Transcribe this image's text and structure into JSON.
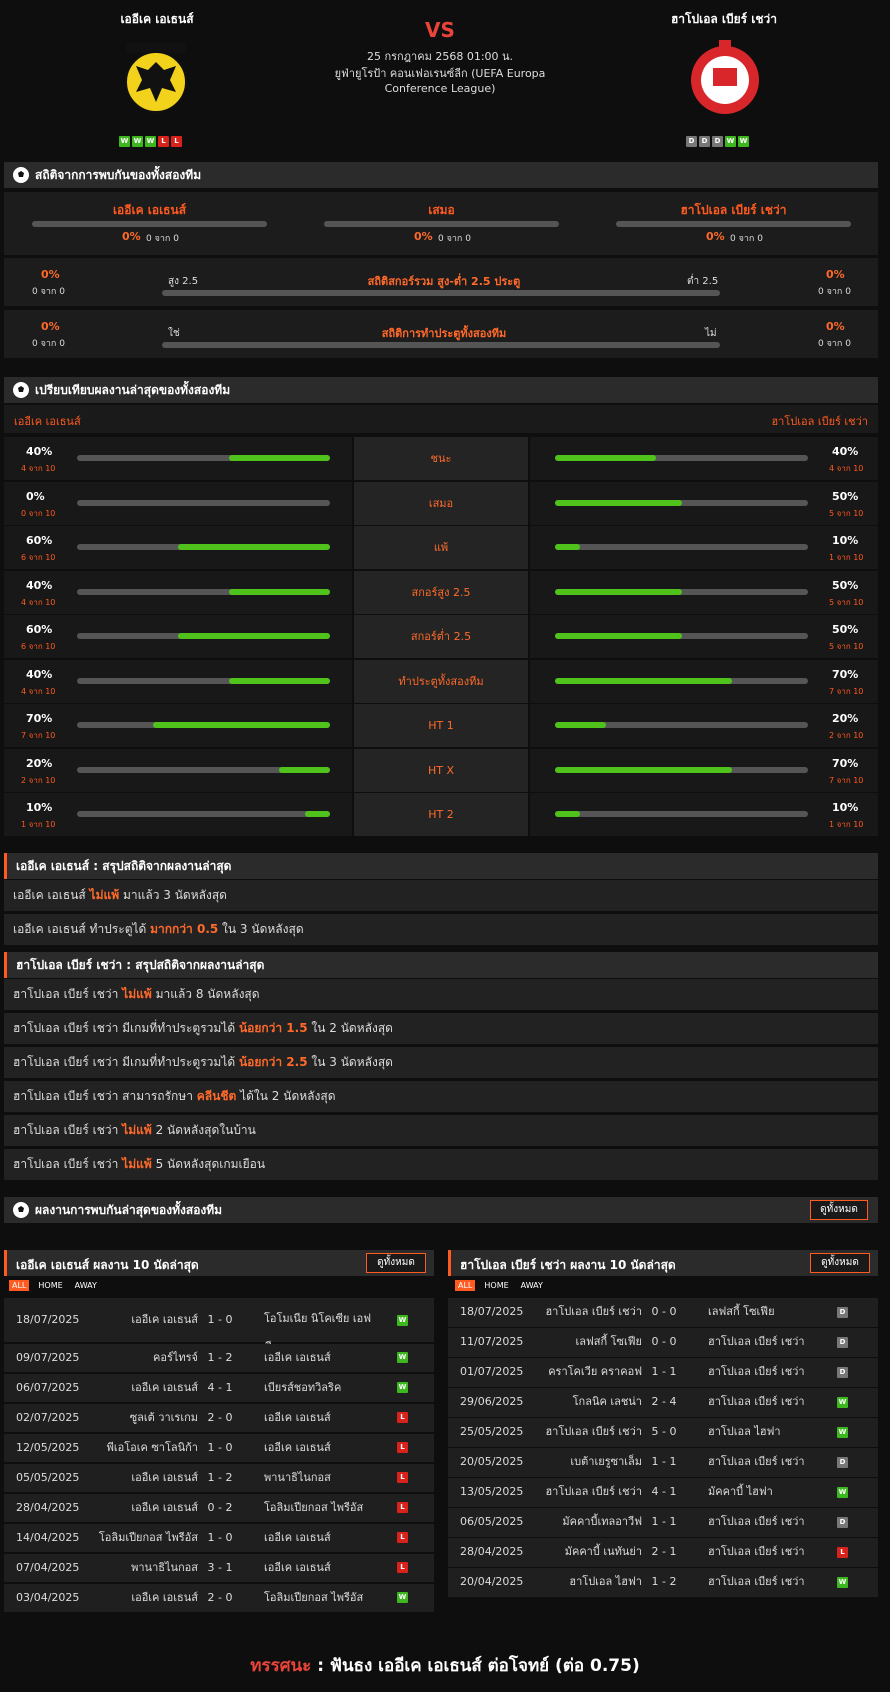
{
  "home": {
    "name": "เออีเค เอเธนส์",
    "form": [
      "W",
      "W",
      "W",
      "L",
      "L"
    ]
  },
  "away": {
    "name": "ฮาโปเอล เบียร์ เชว่า",
    "form": [
      "D",
      "D",
      "D",
      "W",
      "W"
    ]
  },
  "match": {
    "vs": "VS",
    "date": "25 กรกฎาคม 2568 01:00 น.",
    "league1": "ยูฟ่ายูโรป้า คอนเฟอเรนซ์ลีก (UEFA Europa",
    "league2": "Conference League)"
  },
  "h2h": {
    "title": "สถิติจากการพบกันของทั้งสองทีม",
    "cols": [
      {
        "label": "เออีเค เอเธนส์",
        "pct": "0%",
        "of": "0 จาก 0",
        "value": 0
      },
      {
        "label": "เสมอ",
        "pct": "0%",
        "of": "0 จาก 0",
        "value": 0
      },
      {
        "label": "ฮาโปเอล เบียร์ เชว่า",
        "pct": "0%",
        "of": "0 จาก 0",
        "value": 0
      }
    ],
    "ou": {
      "title": "สถิติสกอร์รวม สูง-ต่ำ 2.5 ประตู",
      "left_label": "สูง 2.5",
      "right_label": "ต่ำ 2.5",
      "left_pct": "0%",
      "left_of": "0 จาก 0",
      "right_pct": "0%",
      "right_of": "0 จาก 0"
    },
    "btts": {
      "title": "สถิติการทำประตูทั้งสองทีม",
      "left_label": "ใช่",
      "right_label": "ไม่",
      "left_pct": "0%",
      "left_of": "0 จาก 0",
      "right_pct": "0%",
      "right_of": "0 จาก 0"
    }
  },
  "compare": {
    "title": "เปรียบเทียบผลงานล่าสุดของทั้งสองทีม",
    "home_label": "เออีเค เอเธนส์",
    "away_label": "ฮาโปเอล เบียร์ เชว่า",
    "rows": [
      {
        "label": "ชนะ",
        "h_pct": "40%",
        "h_of": "4 จาก 10",
        "h_val": 40,
        "a_pct": "40%",
        "a_of": "4 จาก 10",
        "a_val": 40
      },
      {
        "label": "เสมอ",
        "h_pct": "0%",
        "h_of": "0 จาก 10",
        "h_val": 0,
        "a_pct": "50%",
        "a_of": "5 จาก 10",
        "a_val": 50
      },
      {
        "label": "แพ้",
        "h_pct": "60%",
        "h_of": "6 จาก 10",
        "h_val": 60,
        "a_pct": "10%",
        "a_of": "1 จาก 10",
        "a_val": 10
      },
      {
        "label": "สกอร์สูง 2.5",
        "h_pct": "40%",
        "h_of": "4 จาก 10",
        "h_val": 40,
        "a_pct": "50%",
        "a_of": "5 จาก 10",
        "a_val": 50
      },
      {
        "label": "สกอร์ต่ำ 2.5",
        "h_pct": "60%",
        "h_of": "6 จาก 10",
        "h_val": 60,
        "a_pct": "50%",
        "a_of": "5 จาก 10",
        "a_val": 50
      },
      {
        "label": "ทำประตูทั้งสองทีม",
        "h_pct": "40%",
        "h_of": "4 จาก 10",
        "h_val": 40,
        "a_pct": "70%",
        "a_of": "7 จาก 10",
        "a_val": 70
      },
      {
        "label": "HT 1",
        "h_pct": "70%",
        "h_of": "7 จาก 10",
        "h_val": 70,
        "a_pct": "20%",
        "a_of": "2 จาก 10",
        "a_val": 20
      },
      {
        "label": "HT X",
        "h_pct": "20%",
        "h_of": "2 จาก 10",
        "h_val": 20,
        "a_pct": "70%",
        "a_of": "7 จาก 10",
        "a_val": 70
      },
      {
        "label": "HT 2",
        "h_pct": "10%",
        "h_of": "1 จาก 10",
        "h_val": 10,
        "a_pct": "10%",
        "a_of": "1 จาก 10",
        "a_val": 10
      }
    ]
  },
  "home_summary": {
    "title": "เออีเค เอเธนส์ : สรุปสถิติจากผลงานล่าสุด",
    "lines": [
      [
        "เออีเค เอเธนส์ ",
        "ไม่แพ้",
        " มาแล้ว 3 นัดหลังสุด"
      ],
      [
        "เออีเค เอเธนส์ ทำประตูได้ ",
        "มากกว่า 0.5",
        " ใน 3 นัดหลังสุด"
      ]
    ]
  },
  "away_summary": {
    "title": "ฮาโปเอล เบียร์ เชว่า : สรุปสถิติจากผลงานล่าสุด",
    "lines": [
      [
        "ฮาโปเอล เบียร์ เชว่า ",
        "ไม่แพ้",
        " มาแล้ว 8 นัดหลังสุด"
      ],
      [
        "ฮาโปเอล เบียร์ เชว่า มีเกมที่ทำประตูรวมได้ ",
        "น้อยกว่า 1.5",
        " ใน 2 นัดหลังสุด"
      ],
      [
        "ฮาโปเอล เบียร์ เชว่า มีเกมที่ทำประตูรวมได้ ",
        "น้อยกว่า 2.5",
        " ใน 3 นัดหลังสุด"
      ],
      [
        "ฮาโปเอล เบียร์ เชว่า สามารถรักษา ",
        "คลีนชีต",
        " ได้ใน 2 นัดหลังสุด"
      ],
      [
        "ฮาโปเอล เบียร์ เชว่า ",
        "ไม่แพ้",
        " 2 นัดหลังสุดในบ้าน"
      ],
      [
        "ฮาโปเอล เบียร์ เชว่า ",
        "ไม่แพ้",
        " 5 นัดหลังสุดเกมเยือน"
      ]
    ]
  },
  "results": {
    "title": "ผลงานการพบกันล่าสุดของทั้งสองทีม",
    "see_all": "ดูทั้งหมด",
    "tabs": [
      "ALL",
      "HOME",
      "AWAY"
    ],
    "home_title": "เออีเค เอเธนส์ ผลงาน 10 นัดล่าสุด",
    "away_title": "ฮาโปเอล เบียร์ เชว่า ผลงาน 10 นัดล่าสุด",
    "home_rows": [
      [
        "18/07/2025",
        "เออีเค เอเธนส์",
        "1 - 0",
        "โอโมเนีย นิโคเซีย เอฟ",
        "W",
        "ซี"
      ],
      [
        "09/07/2025",
        "คอร์ไทรจ์",
        "1 - 2",
        "เออีเค เอเธนส์",
        "W",
        ""
      ],
      [
        "06/07/2025",
        "เออีเค เอเธนส์",
        "4 - 1",
        "เบียรส์ชอทวิลริค",
        "W",
        ""
      ],
      [
        "02/07/2025",
        "ซูลเต้ วาเรเกม",
        "2 - 0",
        "เออีเค เอเธนส์",
        "L",
        ""
      ],
      [
        "12/05/2025",
        "พีเอโอเค ซาโลนิก้า",
        "1 - 0",
        "เออีเค เอเธนส์",
        "L",
        ""
      ],
      [
        "05/05/2025",
        "เออีเค เอเธนส์",
        "1 - 2",
        "พานาธิไนกอส",
        "L",
        ""
      ],
      [
        "28/04/2025",
        "เออีเค เอเธนส์",
        "0 - 2",
        "โอลิมเปียกอส ไพรีอัส",
        "L",
        ""
      ],
      [
        "14/04/2025",
        "โอลิมเปียกอส ไพรีอัส",
        "1 - 0",
        "เออีเค เอเธนส์",
        "L",
        ""
      ],
      [
        "07/04/2025",
        "พานาธิไนกอส",
        "3 - 1",
        "เออีเค เอเธนส์",
        "L",
        ""
      ],
      [
        "03/04/2025",
        "เออีเค เอเธนส์",
        "2 - 0",
        "โอลิมเปียกอส ไพรีอัส",
        "W",
        ""
      ]
    ],
    "away_rows": [
      [
        "18/07/2025",
        "ฮาโปเอล เบียร์ เชว่า",
        "0 - 0",
        "เลฟสกี้ โซเฟีย",
        "D"
      ],
      [
        "11/07/2025",
        "เลฟสกี้ โซเฟีย",
        "0 - 0",
        "ฮาโปเอล เบียร์ เชว่า",
        "D"
      ],
      [
        "01/07/2025",
        "คราโคเวีย คราคอฟ",
        "1 - 1",
        "ฮาโปเอล เบียร์ เชว่า",
        "D"
      ],
      [
        "29/06/2025",
        "โกลนิค เลชน่า",
        "2 - 4",
        "ฮาโปเอล เบียร์ เชว่า",
        "W"
      ],
      [
        "25/05/2025",
        "ฮาโปเอล เบียร์ เชว่า",
        "5 - 0",
        "ฮาโปเอล ไฮฟา",
        "W"
      ],
      [
        "20/05/2025",
        "เบต้าเยรูซาเล็ม",
        "1 - 1",
        "ฮาโปเอล เบียร์ เชว่า",
        "D"
      ],
      [
        "13/05/2025",
        "ฮาโปเอล เบียร์ เชว่า",
        "4 - 1",
        "มัคคาบี้ ไฮฟา",
        "W"
      ],
      [
        "06/05/2025",
        "มัคคาบี้เทลอาวีฟ",
        "1 - 1",
        "ฮาโปเอล เบียร์ เชว่า",
        "D"
      ],
      [
        "28/04/2025",
        "มัคคาบี้ เนทันย่า",
        "2 - 1",
        "ฮาโปเอล เบียร์ เชว่า",
        "L"
      ],
      [
        "20/04/2025",
        "ฮาโปเอล ไฮฟา",
        "1 - 2",
        "ฮาโปเอล เบียร์ เชว่า",
        "W"
      ]
    ]
  },
  "prediction": {
    "label": "ทรรศนะ",
    "sep": " :  ",
    "text": "ฟันธง เออีเค เอเธนส์ ต่อโจทย์ (ต่อ 0.75)"
  }
}
